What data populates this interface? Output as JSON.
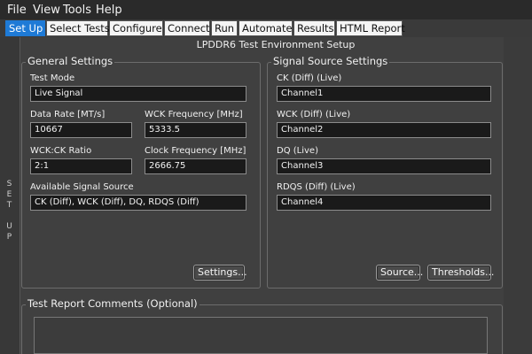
{
  "menu": {
    "items": [
      "File",
      "View",
      "Tools",
      "Help"
    ]
  },
  "tabs": [
    {
      "label": "Set Up",
      "active": true
    },
    {
      "label": "Select Tests",
      "active": false
    },
    {
      "label": "Configure",
      "active": false
    },
    {
      "label": "Connect",
      "active": false
    },
    {
      "label": "Run",
      "active": false
    },
    {
      "label": "Automate",
      "active": false
    },
    {
      "label": "Results",
      "active": false
    },
    {
      "label": "HTML Report",
      "active": false
    }
  ],
  "side_rail": {
    "label_letters": [
      "S",
      "E",
      "T",
      "",
      "U",
      "P"
    ]
  },
  "page": {
    "title": "LPDDR6 Test Environment Setup"
  },
  "general": {
    "title": "General Settings",
    "test_mode_label": "Test Mode",
    "test_mode_value": "Live Signal",
    "data_rate_label": "Data Rate [MT/s]",
    "data_rate_value": "10667",
    "wck_freq_label": "WCK Frequency [MHz]",
    "wck_freq_value": "5333.5",
    "ratio_label": "WCK:CK Ratio",
    "ratio_value": "2:1",
    "clock_freq_label": "Clock Frequency [MHz]",
    "clock_freq_value": "2666.75",
    "available_label": "Available Signal Source",
    "available_value": "CK (Diff), WCK (Diff), DQ, RDQS (Diff)",
    "settings_button": "Settings..."
  },
  "signal": {
    "title": "Signal Source Settings",
    "ck_label": "CK (Diff) (Live)",
    "ck_value": "Channel1",
    "wck_label": "WCK (Diff) (Live)",
    "wck_value": "Channel2",
    "dq_label": "DQ (Live)",
    "dq_value": "Channel3",
    "rdqs_label": "RDQS (Diff) (Live)",
    "rdqs_value": "Channel4",
    "source_button": "Source...",
    "thresholds_button": "Thresholds..."
  },
  "comments": {
    "title": "Test Report Comments (Optional)",
    "value": ""
  },
  "colors": {
    "active_tab": "#1e7ad6",
    "panel_bg": "#404040",
    "field_bg": "#1a1a1a"
  }
}
